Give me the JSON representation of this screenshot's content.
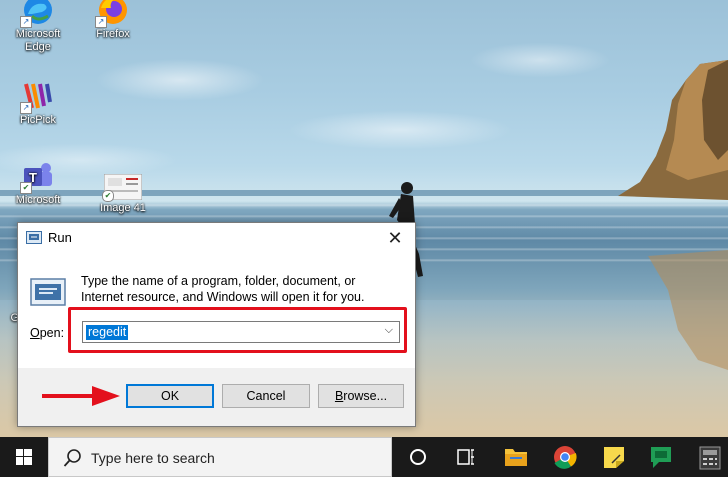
{
  "desktop": {
    "icons": [
      {
        "label": "Microsoft\nEdge",
        "icon": "edge-icon"
      },
      {
        "label": "Firefox",
        "icon": "firefox-icon"
      },
      {
        "label": "PicPick",
        "icon": "picpick-icon"
      },
      {
        "label": "Microsoft",
        "icon": "teams-icon"
      },
      {
        "label": "Image 41",
        "icon": "image-file-icon"
      },
      {
        "label": "G",
        "icon": "partial-icon"
      }
    ]
  },
  "run_dialog": {
    "title": "Run",
    "description": "Type the name of a program, folder, document, or Internet resource, and Windows will open it for you.",
    "open_label_underlined": "O",
    "open_label_rest": "pen:",
    "input_value": "regedit",
    "buttons": {
      "ok": "OK",
      "cancel": "Cancel",
      "browse_underlined": "B",
      "browse_rest": "rowse..."
    },
    "highlight_color": "#e3101c"
  },
  "taskbar": {
    "search_placeholder": "Type here to search",
    "pinned": [
      "cortana-icon",
      "task-view-icon",
      "file-explorer-icon",
      "chrome-icon",
      "sticky-notes-icon",
      "hangouts-icon",
      "calculator-icon"
    ]
  },
  "colors": {
    "accent": "#0078d7",
    "annotation_red": "#e3101c",
    "taskbar": "#1a1a1a"
  }
}
